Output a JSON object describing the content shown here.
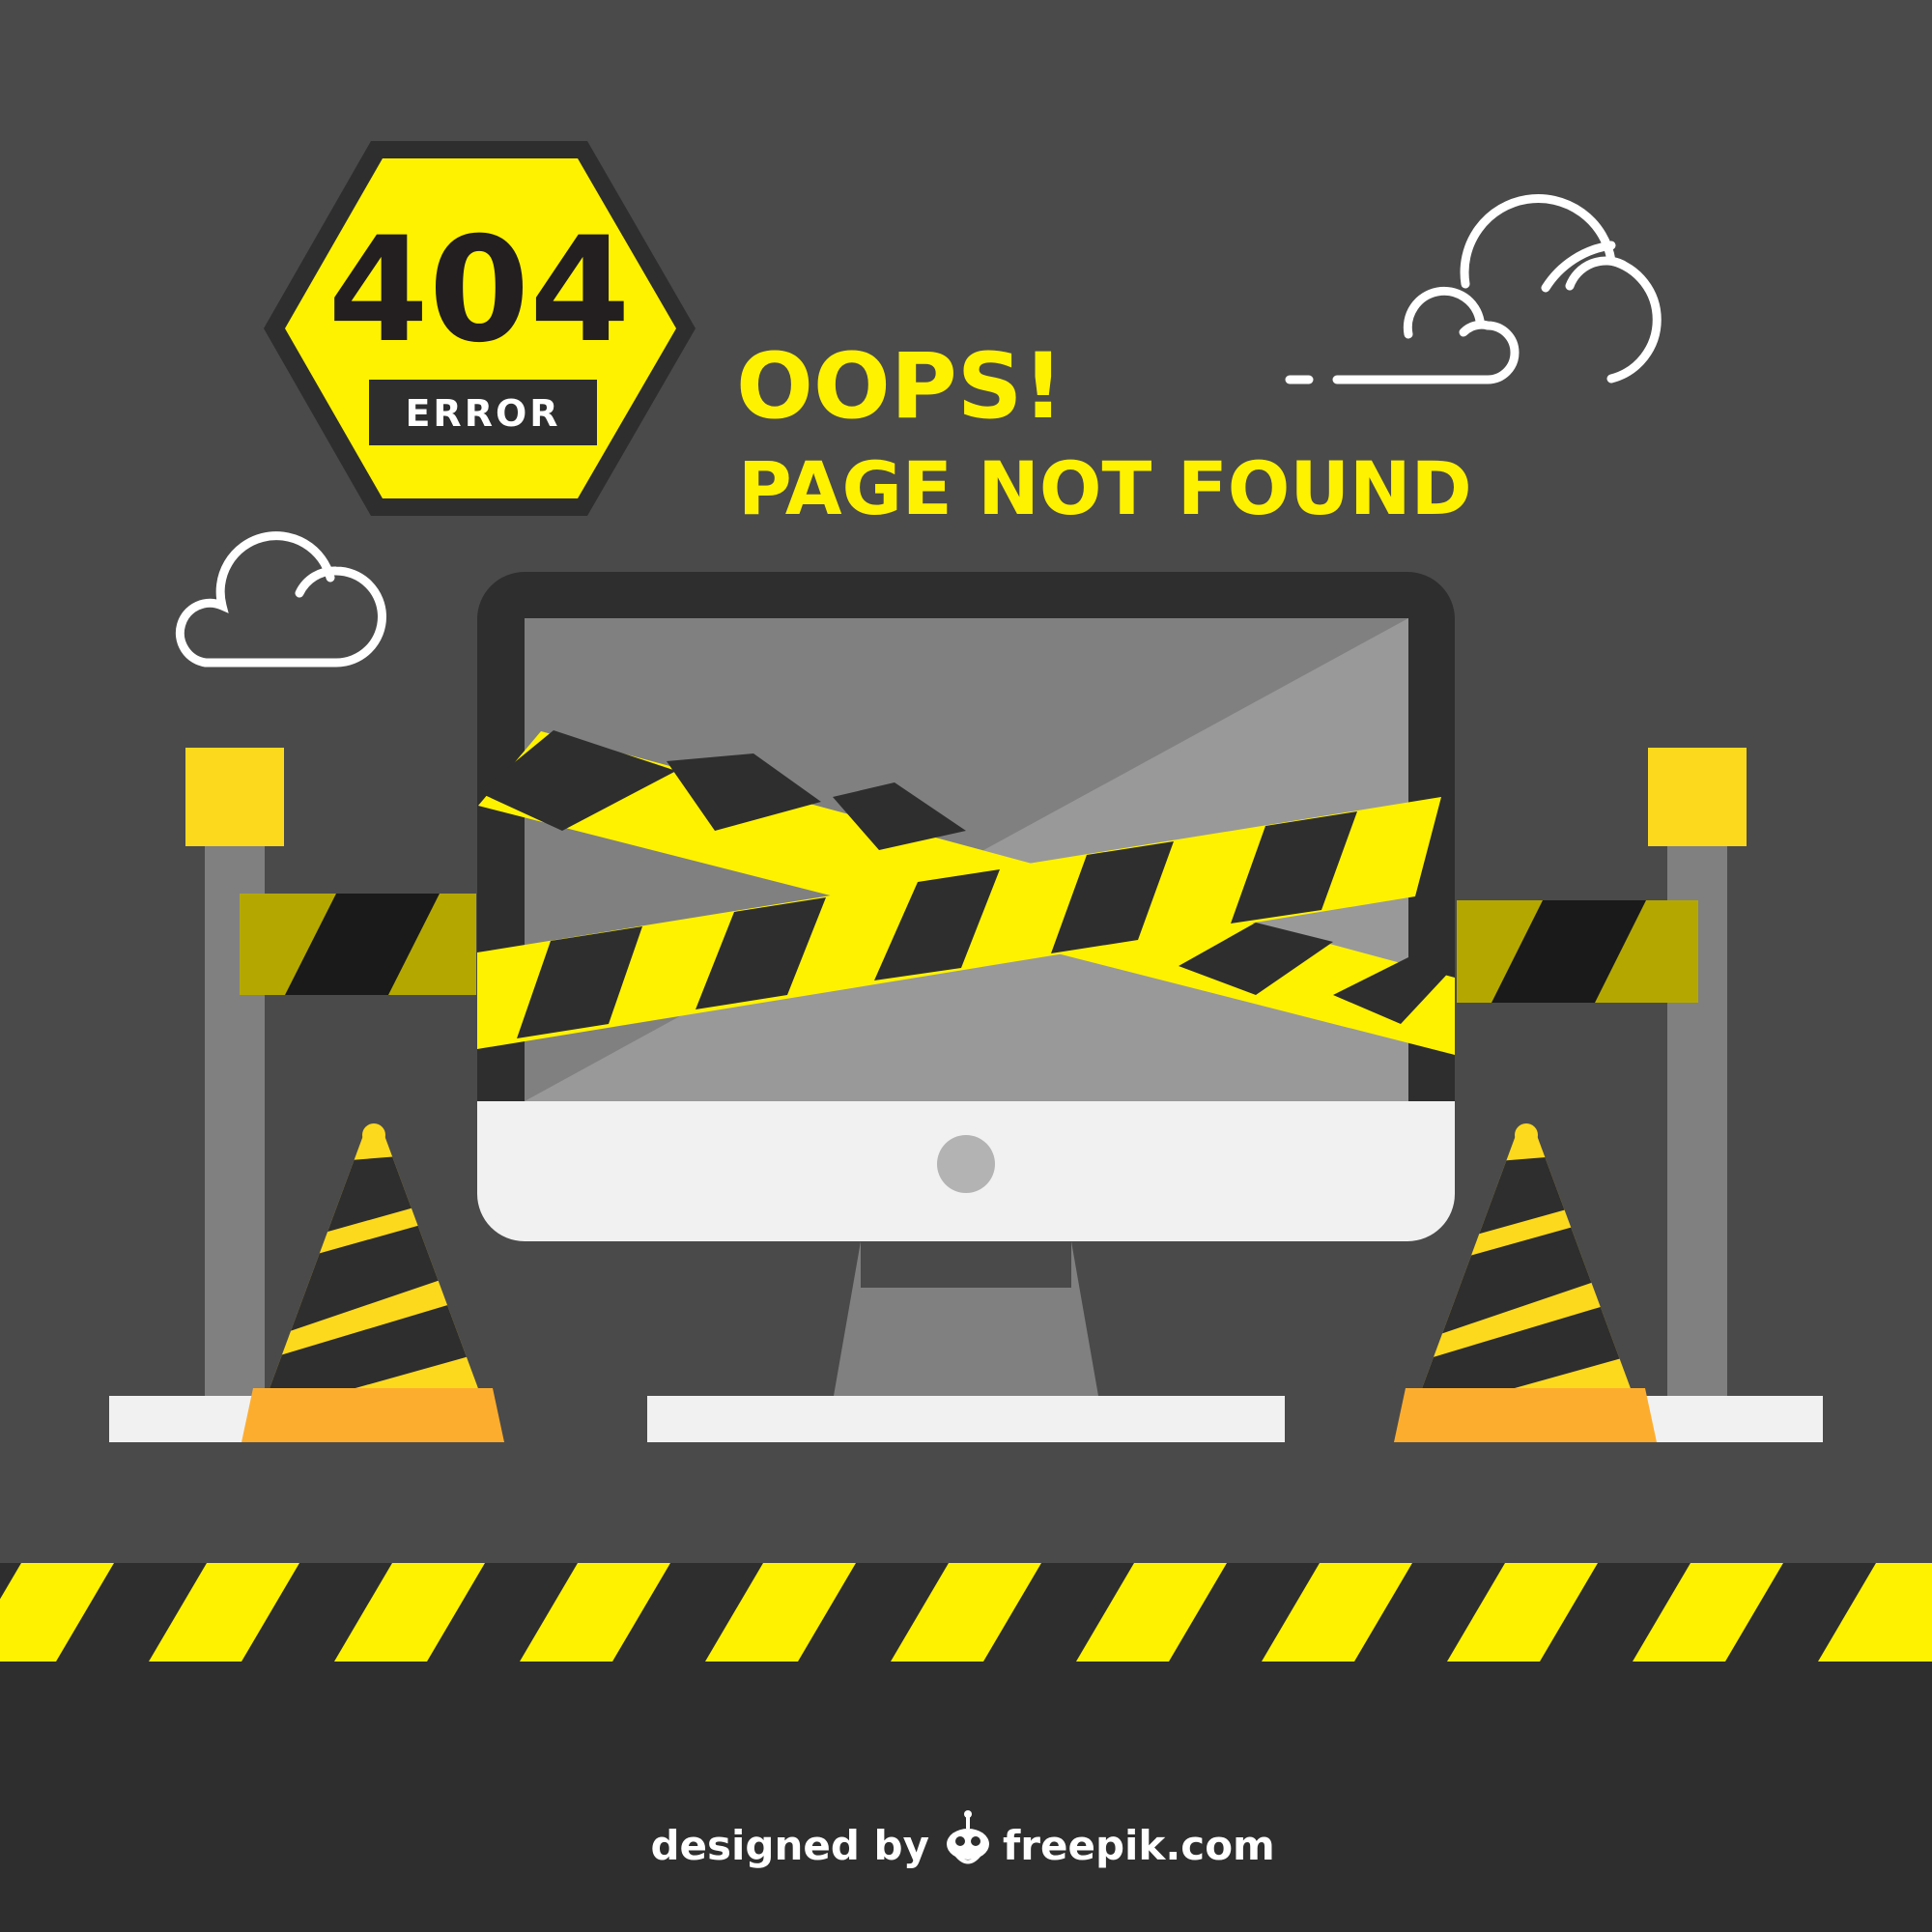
{
  "sign": {
    "code": "404",
    "label": "ERROR"
  },
  "heading": {
    "title": "OOPS!",
    "subtitle": "PAGE NOT FOUND"
  },
  "credit": {
    "prefix": "designed by",
    "site": "freepik.com"
  },
  "colors": {
    "background": "#4a4a4a",
    "dark": "#2e2e2e",
    "yellow": "#fff200",
    "cone_yellow": "#fdd91e",
    "orange": "#fdad2e",
    "white": "#f1f1f1",
    "post_grey": "#808080",
    "tape_olive": "#b4a800"
  },
  "icons": [
    "hexagon-sign-icon",
    "cloud-icon",
    "computer-monitor-icon",
    "traffic-cone-icon",
    "barrier-post-icon",
    "caution-tape-icon",
    "freepik-logo-icon"
  ]
}
